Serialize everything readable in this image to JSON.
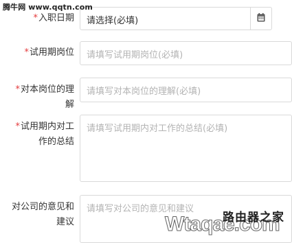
{
  "watermark": {
    "top_text": "腾牛网 www.qqtn.com",
    "bottom_big_text": "Wtaqae.com",
    "bottom_cn_text": "路由器之家"
  },
  "form": {
    "required_marker": "*",
    "entry_date": {
      "label": "入职日期",
      "value": "请选择(必填)"
    },
    "probation_post": {
      "label": "试用期岗位",
      "placeholder": "请填写试用期岗位(必填)"
    },
    "post_understanding": {
      "label_line1": "对本岗位的理",
      "label_line2": "解",
      "placeholder": "请填写对本岗位的理解(必填)"
    },
    "probation_summary": {
      "label_line1": "试用期内对工",
      "label_line2": "作的总结",
      "placeholder": "请填写试用期内对工作的总结(必填)"
    },
    "company_advice": {
      "label_line1": "对公司的意见和",
      "label_line2": "建议",
      "placeholder": "请填写对公司的意见和建议"
    }
  },
  "colors": {
    "required": "#e4393c",
    "border": "#d9d9d9",
    "placeholder": "#b3b3b3",
    "text": "#333333"
  },
  "icons": {
    "calendar": "calendar-icon"
  }
}
